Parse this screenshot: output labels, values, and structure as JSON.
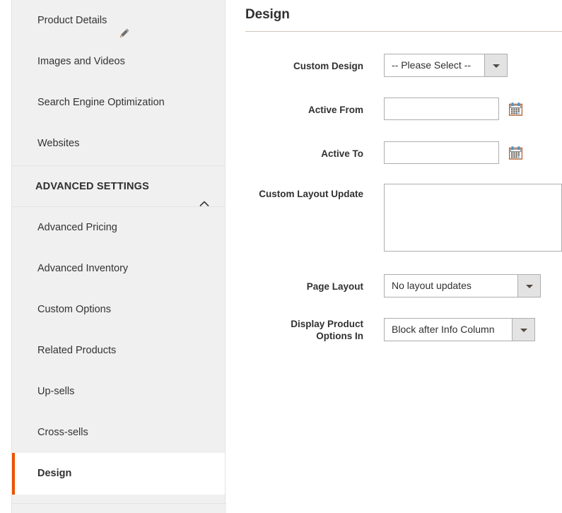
{
  "sidebar": {
    "basic_items": [
      {
        "label": "Product Details",
        "icon": "pencil-icon",
        "has_icon": true
      },
      {
        "label": "Images and Videos",
        "has_icon": false
      },
      {
        "label": "Search Engine Optimization",
        "has_icon": false
      },
      {
        "label": "Websites",
        "has_icon": false
      }
    ],
    "section": {
      "title": "ADVANCED SETTINGS",
      "chevron": "chevron-up-icon",
      "expanded": true
    },
    "advanced_items": [
      {
        "label": "Advanced Pricing",
        "active": false
      },
      {
        "label": "Advanced Inventory",
        "active": false
      },
      {
        "label": "Custom Options",
        "active": false
      },
      {
        "label": "Related Products",
        "active": false
      },
      {
        "label": "Up-sells",
        "active": false
      },
      {
        "label": "Cross-sells",
        "active": false
      },
      {
        "label": "Design",
        "active": true
      }
    ]
  },
  "content": {
    "title": "Design",
    "fields": {
      "custom_design": {
        "label": "Custom Design",
        "value": "-- Please Select --",
        "control": "select"
      },
      "active_from": {
        "label": "Active From",
        "value": "",
        "placeholder": "",
        "control": "date",
        "icon": "calendar-icon"
      },
      "active_to": {
        "label": "Active To",
        "value": "",
        "placeholder": "",
        "control": "date",
        "icon": "calendar-icon"
      },
      "custom_layout_update": {
        "label": "Custom Layout Update",
        "value": "",
        "placeholder": "",
        "control": "textarea"
      },
      "page_layout": {
        "label": "Page Layout",
        "value": "No layout updates",
        "control": "select"
      },
      "display_product_options_in": {
        "label": "Display Product\nOptions In",
        "label_line1": "Display Product",
        "label_line2": "Options In",
        "value": "Block after Info Column",
        "control": "select"
      }
    }
  },
  "colors": {
    "accent_orange": "#eb5202",
    "sidebar_bg": "#f0f0f0",
    "divider": "#e3e3e3",
    "title_rule": "#cfc6bc",
    "text_dark": "#303030",
    "control_border": "#adadad",
    "select_button_bg": "#e3e3e3"
  }
}
